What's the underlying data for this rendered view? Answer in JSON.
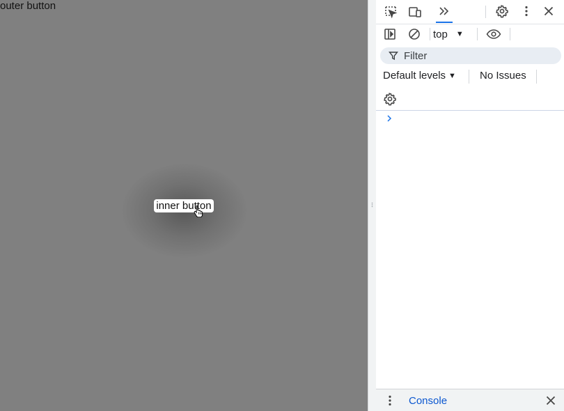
{
  "page": {
    "outer_button_label": "outer button",
    "inner_button_label": "inner button"
  },
  "devtools": {
    "tabbar": {
      "icons": [
        "select-element-icon",
        "device-toolbar-icon",
        "more-tabs-icon",
        "settings-icon",
        "kebab-menu-icon",
        "close-icon"
      ]
    },
    "console_toolbar": {
      "context": "top"
    },
    "filter": {
      "placeholder": "Filter"
    },
    "levels": {
      "label": "Default levels",
      "issues": "No Issues"
    },
    "drawer": {
      "tab_label": "Console"
    }
  },
  "colors": {
    "page_background": "#808080",
    "accent": "#1a73e8",
    "drawer_tab_text": "#0b57d0"
  }
}
